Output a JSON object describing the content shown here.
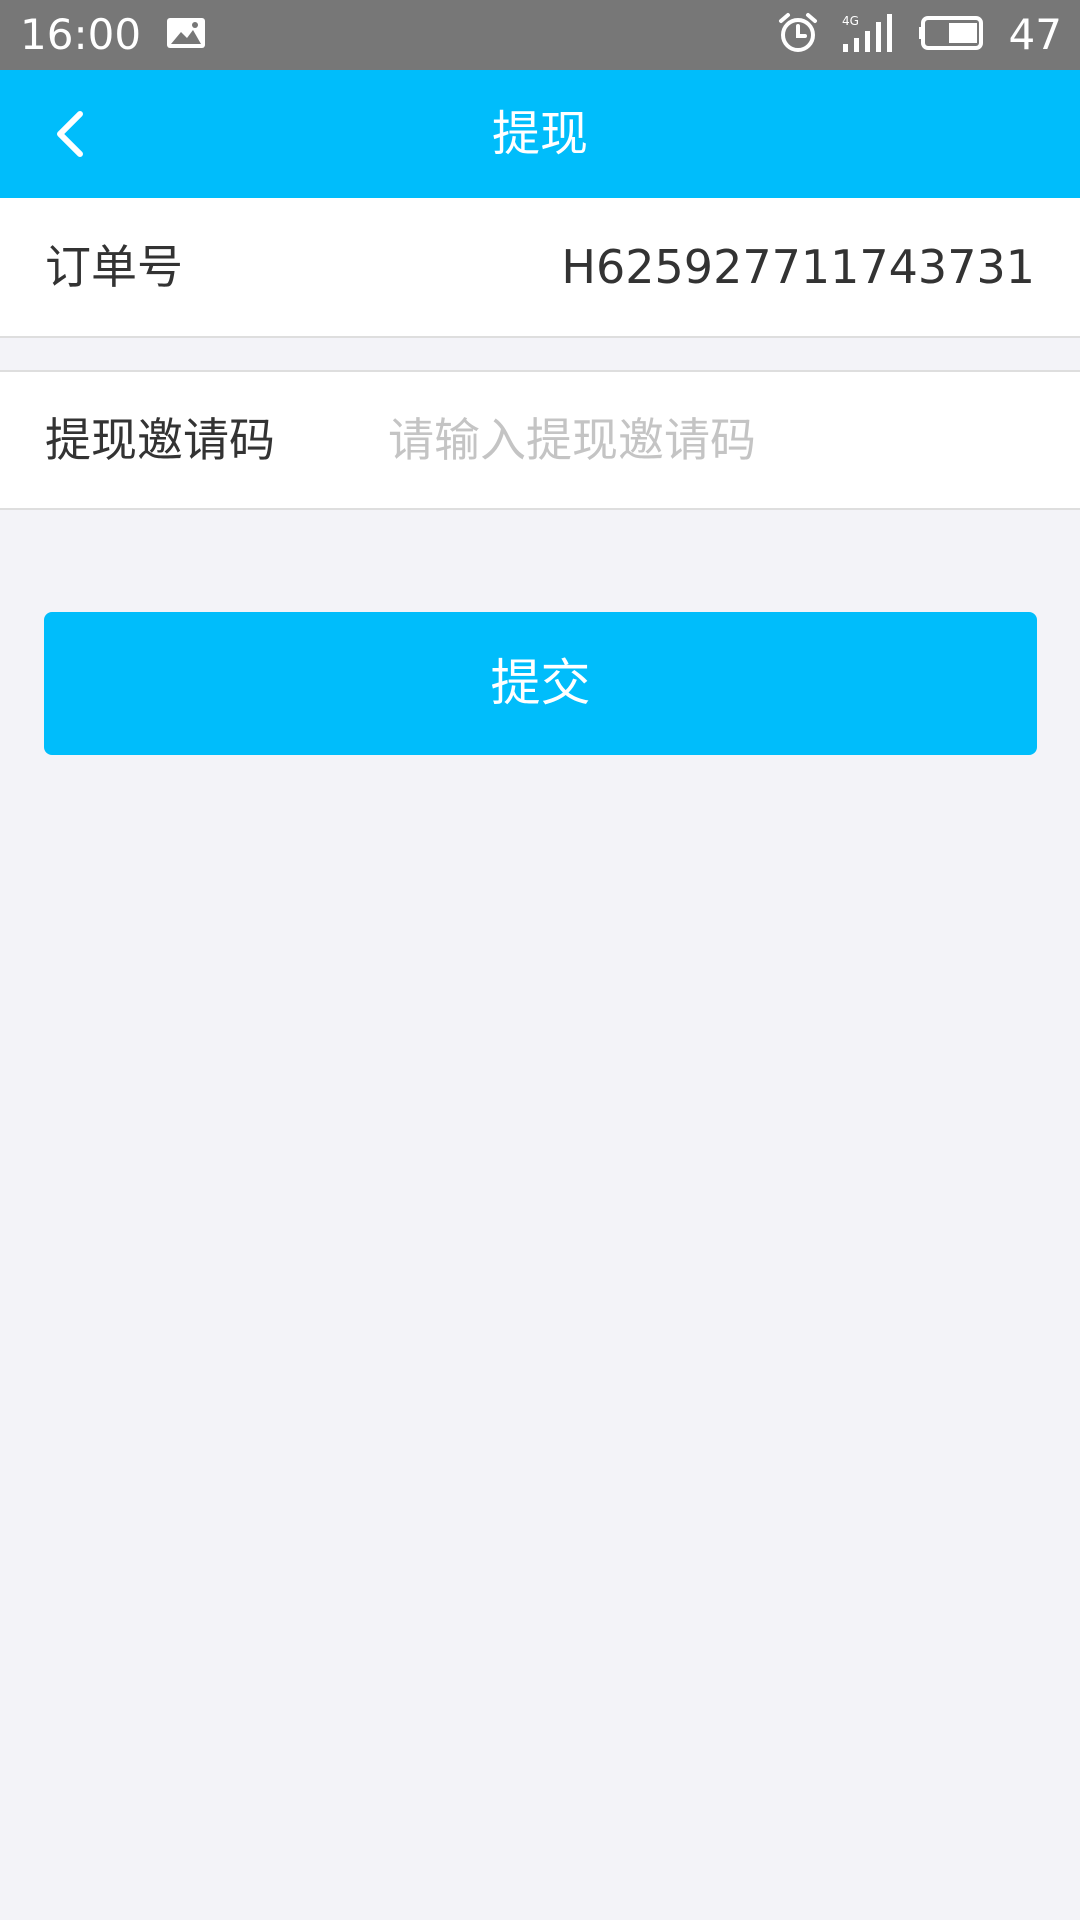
{
  "status_bar": {
    "time": "16:00",
    "network": "4G",
    "battery_level": "47",
    "icons": [
      "image-notification-icon",
      "alarm-icon",
      "signal-icon",
      "battery-icon"
    ]
  },
  "app_bar": {
    "title": "提现",
    "back_icon": "chevron-left-icon"
  },
  "form": {
    "order_label": "订单号",
    "order_value": "H625927711743731",
    "invite_label": "提现邀请码",
    "invite_value": "",
    "invite_placeholder": "请输入提现邀请码",
    "submit_label": "提交"
  },
  "colors": {
    "accent": "#00bdfb",
    "status_bar": "#777777",
    "background": "#f3f3f8",
    "text": "#333333",
    "placeholder": "#c4c4c4"
  }
}
